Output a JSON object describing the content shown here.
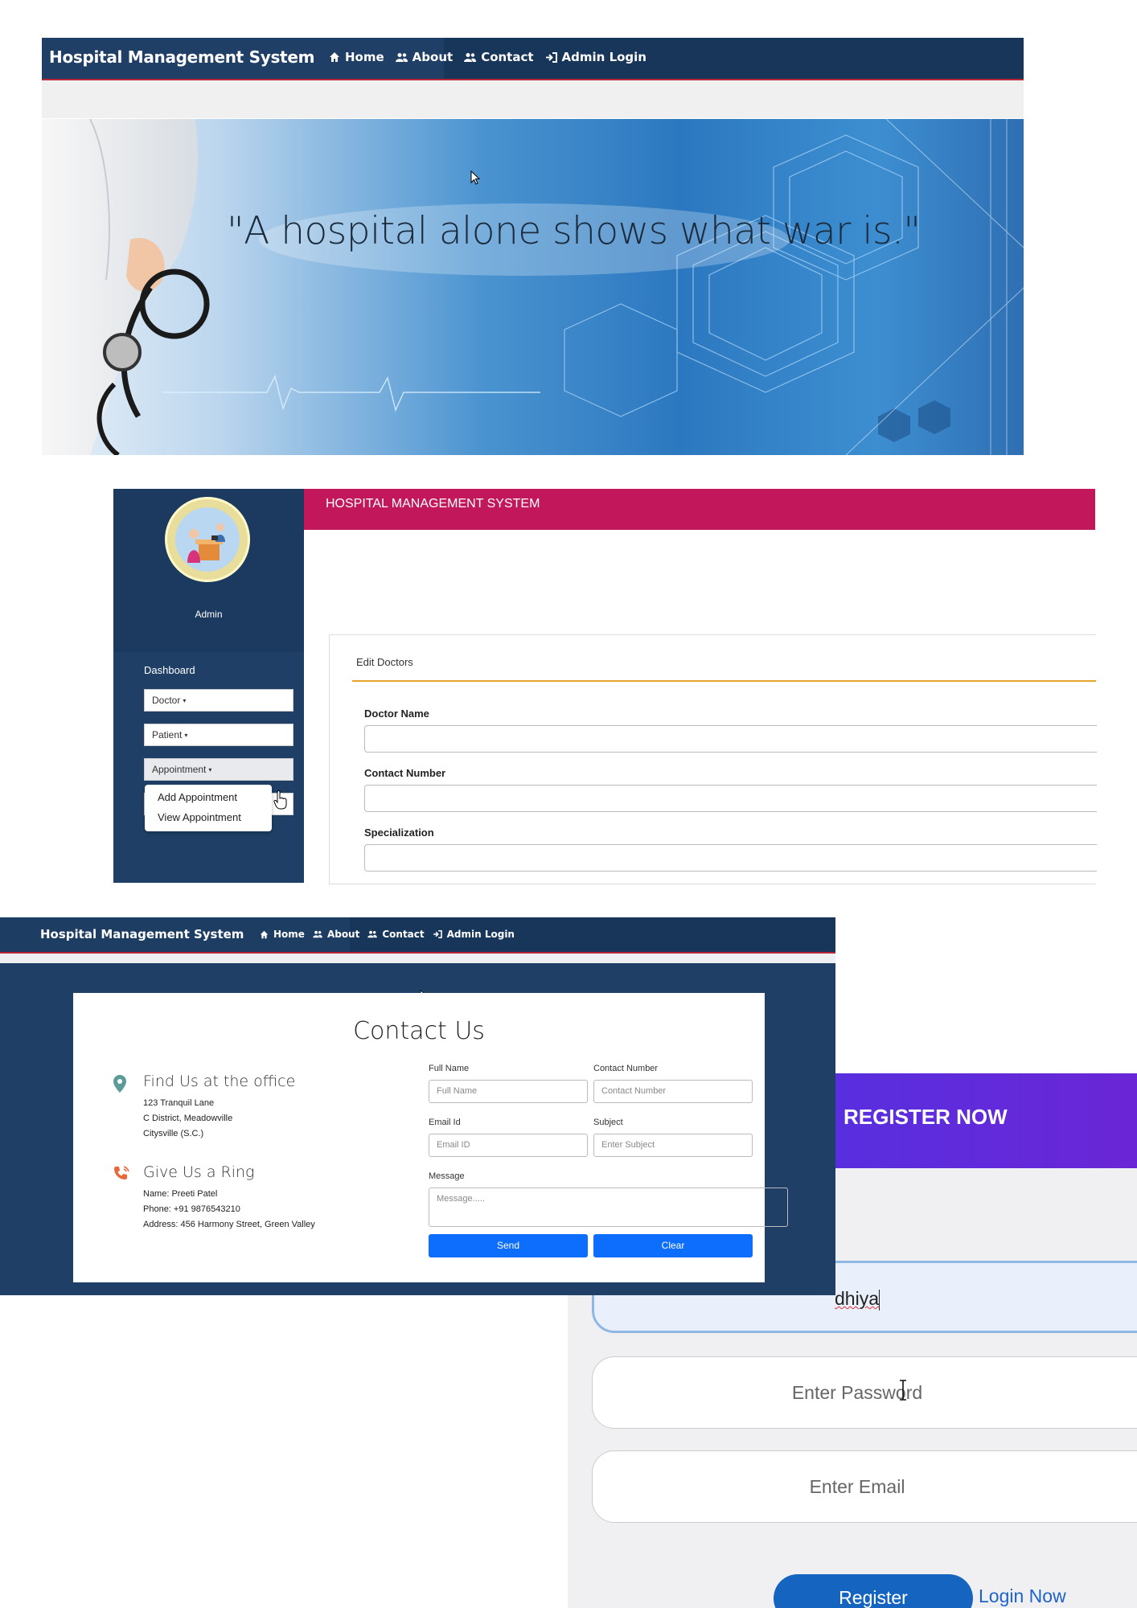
{
  "nav": {
    "brand": "Hospital Management System",
    "links": [
      {
        "label": "Home",
        "icon": "home-icon"
      },
      {
        "label": "About",
        "icon": "users-icon"
      },
      {
        "label": "Contact",
        "icon": "users-icon"
      },
      {
        "label": "Admin Login",
        "icon": "login-icon"
      }
    ]
  },
  "hero": {
    "quote": "\"A hospital alone shows what war is.\""
  },
  "admin": {
    "header_title": "HOSPITAL MANAGEMENT SYSTEM",
    "user_label": "Admin",
    "sidebar": {
      "dashboard": "Dashboard",
      "doctor": "Doctor",
      "patient": "Patient",
      "appointment": "Appointment",
      "dropdown": [
        "Add Appointment",
        "View Appointment"
      ]
    },
    "form": {
      "title": "Edit Doctors",
      "doctor_name_label": "Doctor Name",
      "contact_number_label": "Contact Number",
      "specialization_label": "Specialization"
    }
  },
  "contact": {
    "title": "Contact Us",
    "office": {
      "heading": "Find Us at the office",
      "lines": [
        "123 Tranquil Lane",
        "C District, Meadowville",
        "Citysville (S.C.)"
      ]
    },
    "ring": {
      "heading": "Give Us a Ring",
      "lines": [
        "Name: Preeti Patel",
        "Phone: +91 9876543210",
        "Address: 456 Harmony Street, Green Valley"
      ]
    },
    "form": {
      "full_name_label": "Full Name",
      "full_name_placeholder": "Full Name",
      "contact_label": "Contact Number",
      "contact_placeholder": "Contact Number",
      "email_label": "Email Id",
      "email_placeholder": "Email ID",
      "subject_label": "Subject",
      "subject_placeholder": "Enter Subject",
      "message_label": "Message",
      "message_placeholder": "Message.....",
      "send": "Send",
      "clear": "Clear"
    }
  },
  "register": {
    "header": "REGISTER NOW",
    "username_value": "dhiya",
    "password_placeholder": "Enter Password",
    "email_placeholder": "Enter Email",
    "register_button": "Register",
    "login_link": "Login Now"
  }
}
